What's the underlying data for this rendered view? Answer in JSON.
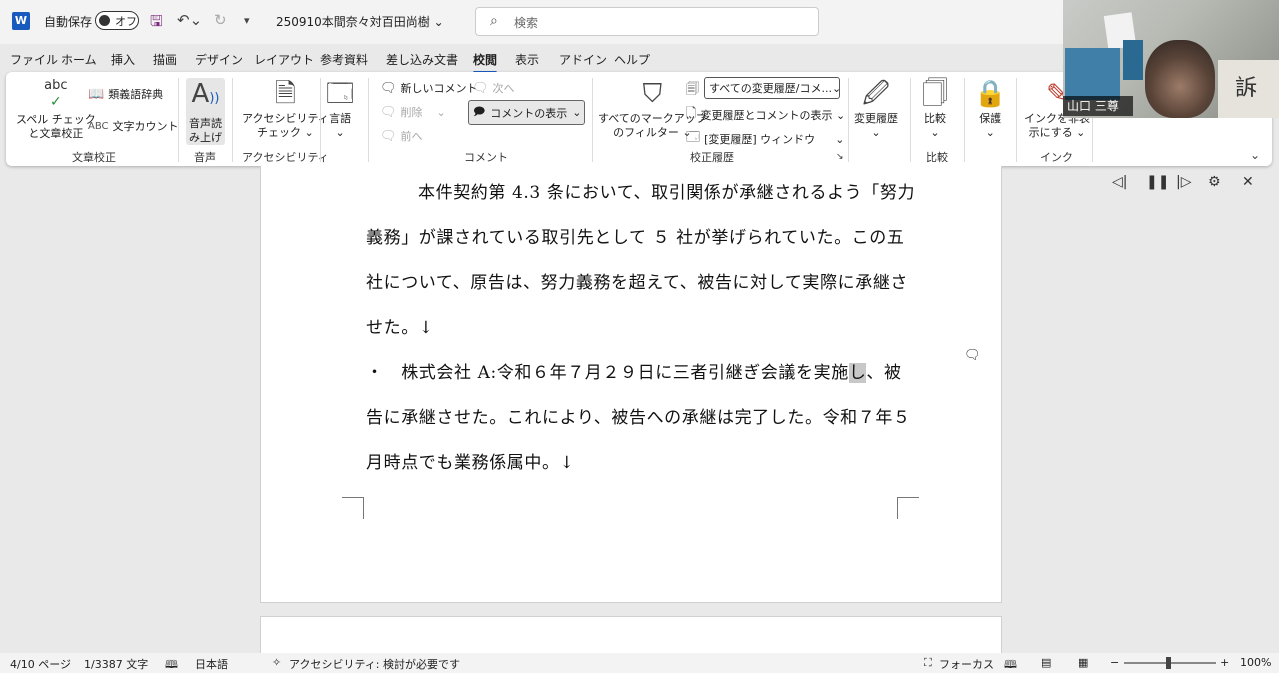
{
  "titlebar": {
    "autosave_label": "自動保存",
    "autosave_state": "オフ",
    "doc_title": "250910本間奈々対百田尚樹 ⌄",
    "search_placeholder": "検索"
  },
  "menu_tabs": [
    "ファイル",
    "ホーム",
    "挿入",
    "描画",
    "デザイン",
    "レイアウト",
    "参考資料",
    "差し込み文書",
    "校閲",
    "表示",
    "アドイン",
    "ヘルプ"
  ],
  "active_tab": "校閲",
  "ribbon": {
    "proofing": {
      "spell_icon_text": "abc",
      "spell_line1": "スペル チェック",
      "spell_line2": "と文章校正",
      "thesaurus": "類義語辞典",
      "word_count": "文字カウント",
      "group": "文章校正"
    },
    "speech": {
      "read_line1": "音声読",
      "read_line2": "み上げ",
      "group": "音声"
    },
    "accessibility": {
      "check_line1": "アクセシビリティ",
      "check_line2": "チェック ⌄",
      "group": "アクセシビリティ"
    },
    "language": {
      "label": "言語",
      "chevron": "⌄"
    },
    "comments": {
      "new": "新しいコメント",
      "delete": "削除",
      "prev": "前へ",
      "next": "次へ",
      "show": "コメントの表示",
      "group": "コメント"
    },
    "tracking": {
      "filter_line1": "すべてのマークアップ",
      "filter_line2": "のフィルター ⌄",
      "markup_select": "すべての変更履歴/コメ...",
      "show_markup": "変更履歴とコメントの表示 ⌄",
      "pane": "[変更履歴] ウィンドウ",
      "group": "校正履歴"
    },
    "changes": {
      "label": "変更履歴",
      "chevron": "⌄"
    },
    "compare": {
      "label": "比較",
      "chevron": "⌄",
      "group": "比較"
    },
    "protect": {
      "label": "保護",
      "chevron": "⌄"
    },
    "ink": {
      "line1": "インクを非表",
      "line2": "示にする ⌄",
      "group": "インク"
    }
  },
  "webcam": {
    "name": "山口 三尊",
    "board_text": "訴"
  },
  "document": {
    "line1": "本件契約第 4.3 条において、取引関係が承継されるよう「努力",
    "line2": "義務」が課されている取引先として ５ 社が挙げられていた。この五",
    "line3": "社について、原告は、努力義務を超えて、被告に対して実際に承継さ",
    "line4": "せた。↓",
    "line5_before": "・　株式会社 A:令和６年７月２９日に三者引継ぎ会議を実施",
    "line5_highlight": "し",
    "line5_after": "、被",
    "line6": "告に承継させた。これにより、被告への承継は完了した。令和７年５",
    "line7": "月時点でも業務係属中。↓"
  },
  "statusbar": {
    "page": "4/10 ページ",
    "words": "1/3387 文字",
    "language": "日本語",
    "accessibility": "アクセシビリティ: 検討が必要です",
    "focus": "フォーカス",
    "zoom_minus": "−",
    "zoom_plus": "+",
    "zoom": "100%"
  }
}
